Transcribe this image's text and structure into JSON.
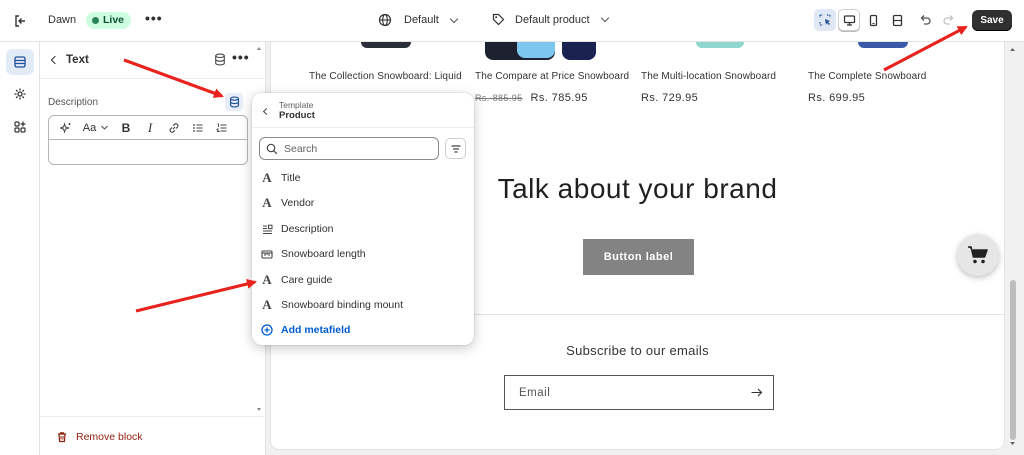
{
  "topbar": {
    "theme_name": "Dawn",
    "live_label": "Live",
    "more_label": "•••",
    "language": "Default",
    "template": "Default product",
    "save_label": "Save"
  },
  "panel": {
    "title": "Text",
    "more_label": "•••",
    "field_label": "Description",
    "remove_block": "Remove block"
  },
  "popover": {
    "eyebrow": "Template",
    "title": "Product",
    "search_placeholder": "Search",
    "items": [
      {
        "label": "Title",
        "icon": "text-icon"
      },
      {
        "label": "Vendor",
        "icon": "text-icon"
      },
      {
        "label": "Description",
        "icon": "rich-text-icon"
      },
      {
        "label": "Snowboard length",
        "icon": "measurement-icon"
      },
      {
        "label": "Care guide",
        "icon": "text-icon"
      },
      {
        "label": "Snowboard binding mount",
        "icon": "text-icon"
      }
    ],
    "add_metafield": "Add metafield"
  },
  "preview": {
    "products": [
      {
        "name": "The Collection Snowboard: Liquid",
        "price": "",
        "old_price": ""
      },
      {
        "name": "The Compare at Price Snowboard",
        "price": "Rs. 785.95",
        "old_price": "Rs. 885.95"
      },
      {
        "name": "The Multi-location Snowboard",
        "price": "Rs. 729.95",
        "old_price": ""
      },
      {
        "name": "The Complete Snowboard",
        "price": "Rs. 699.95",
        "old_price": ""
      }
    ],
    "brand_title": "Talk about your brand",
    "button_label": "Button label",
    "subscribe_title": "Subscribe to our emails",
    "email_placeholder": "Email"
  },
  "colors": {
    "save_bg": "#303030",
    "live_bg": "#cdfee1",
    "link_blue": "#005bd3",
    "danger": "#8e1f0b",
    "annotation_red": "#e8221c"
  }
}
